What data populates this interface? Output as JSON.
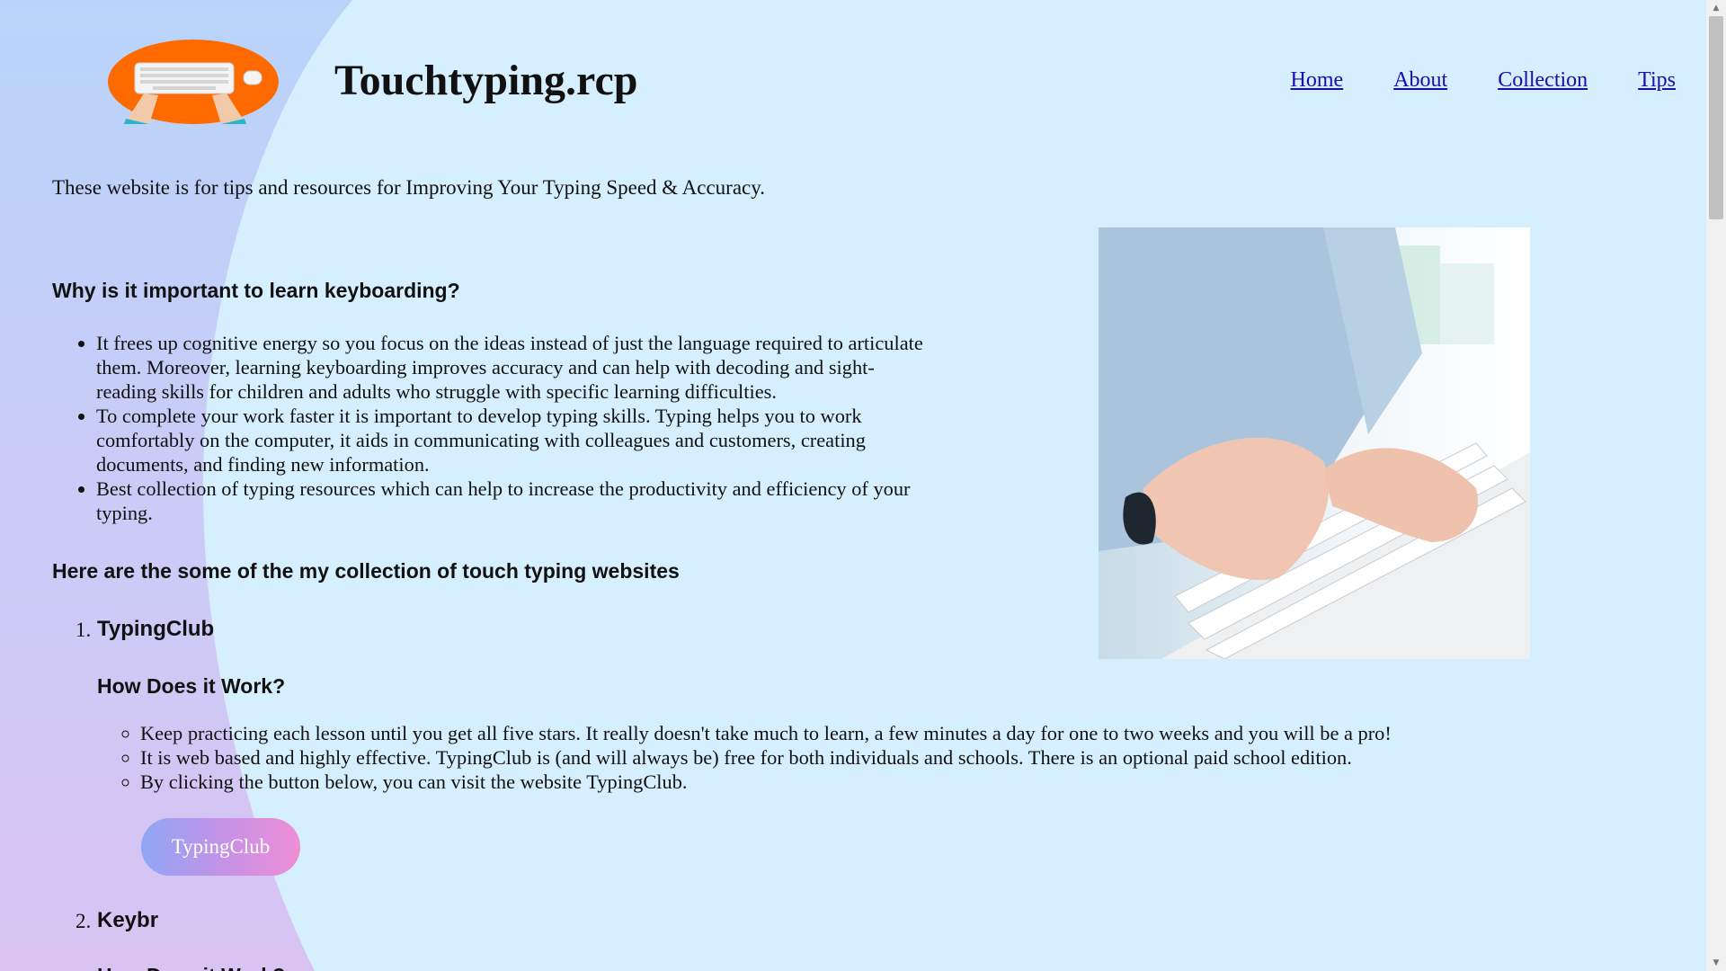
{
  "header": {
    "site_title": "Touchtyping.rcp",
    "nav": [
      "Home",
      "About",
      "Collection",
      "Tips"
    ]
  },
  "intro": "These website is for tips and resources for Improving Your Typing Speed & Accuracy.",
  "why": {
    "heading": "Why is it important to learn keyboarding?",
    "items": [
      "It frees up cognitive energy so you focus on the ideas instead of just the language required to articulate them. Moreover, learning keyboarding improves accuracy and can help with decoding and sight-reading skills for children and adults who struggle with specific learning difficulties.",
      "To complete your work faster it is important to develop typing skills. Typing helps you to work comfortably on the computer, it aids in communicating with colleagues and customers, creating documents, and finding new information.",
      "Best collection of typing resources which can help to increase the productivity and efficiency of your typing."
    ]
  },
  "collection": {
    "heading": "Here are the some of the my collection of touch typing websites",
    "sites": [
      {
        "number": "1.",
        "name": "TypingClub",
        "how_heading": "How Does it Work?",
        "points": [
          "Keep practicing each lesson until you get all five stars. It really doesn't take much to learn, a few minutes a day for one to two weeks and you will be a pro!",
          "It is web based and highly effective. TypingClub is (and will always be) free for both individuals and schools. There is an optional paid school edition.",
          "By clicking the button below, you can visit the website TypingClub."
        ],
        "button": "TypingClub"
      },
      {
        "number": "2.",
        "name": "Keybr",
        "how_heading": "How Does it Work?"
      }
    ]
  },
  "colors": {
    "background": "#d6efff",
    "blob_top": "#b9d4fa",
    "blob_bottom": "#d9c3f3",
    "link": "#1a0dab",
    "logo_orange": "#ff6a00",
    "button_gradient": [
      "#8fa6f4",
      "#c891e6",
      "#ef8ed5"
    ]
  }
}
